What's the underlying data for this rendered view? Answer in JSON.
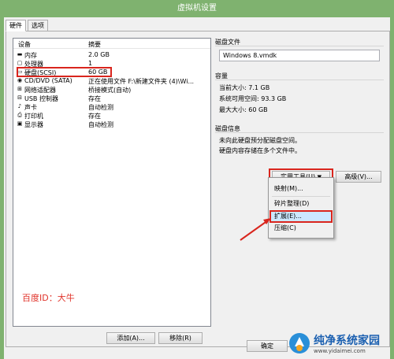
{
  "window": {
    "title": "虚拟机设置"
  },
  "tabs": [
    {
      "label": "硬件"
    },
    {
      "label": "选项"
    }
  ],
  "device_list": {
    "headers": {
      "device": "设备",
      "summary": "摘要"
    },
    "rows": [
      {
        "icon": "memory-icon",
        "name": "内存",
        "summary": "2.0 GB"
      },
      {
        "icon": "processor-icon",
        "name": "处理器",
        "summary": "1"
      },
      {
        "icon": "harddisk-icon",
        "name": "硬盘(SCSI)",
        "summary": "60 GB"
      },
      {
        "icon": "cdrom-icon",
        "name": "CD/DVD (SATA)",
        "summary": "正在使用文件 F:\\新建文件夹 (4)\\Wi..."
      },
      {
        "icon": "network-icon",
        "name": "网络适配器",
        "summary": "桥接模式(自动)"
      },
      {
        "icon": "usb-icon",
        "name": "USB 控制器",
        "summary": "存在"
      },
      {
        "icon": "sound-icon",
        "name": "声卡",
        "summary": "自动检测"
      },
      {
        "icon": "printer-icon",
        "name": "打印机",
        "summary": "存在"
      },
      {
        "icon": "display-icon",
        "name": "显示器",
        "summary": "自动检测"
      }
    ]
  },
  "buttons": {
    "add": "添加(A)...",
    "remove": "移除(R)",
    "ok": "确定",
    "utilities": "实用工具(U)",
    "advanced": "高级(V)..."
  },
  "disk_file": {
    "label": "磁盘文件",
    "value": "Windows 8.vmdk"
  },
  "capacity": {
    "label": "容量",
    "current_size": "当前大小: 7.1 GB",
    "free_space": "系统可用空间: 93.3 GB",
    "max_size": "最大大小: 60 GB"
  },
  "disk_info": {
    "label": "磁盘信息",
    "line1": "未向此硬盘预分配磁盘空间。",
    "line2": "硬盘内容存储在多个文件中。"
  },
  "menu": {
    "items": [
      "映射(M)...",
      "碎片整理(D)",
      "扩展(E)...",
      "压缩(C)"
    ]
  },
  "watermark": "百度ID：大牛",
  "logo": {
    "main": "纯净系统家园",
    "url": "www.yidaimei.com"
  },
  "colors": {
    "titlebar": "#7fb26f",
    "highlight": "#d9251d",
    "accent": "#e0332a"
  }
}
